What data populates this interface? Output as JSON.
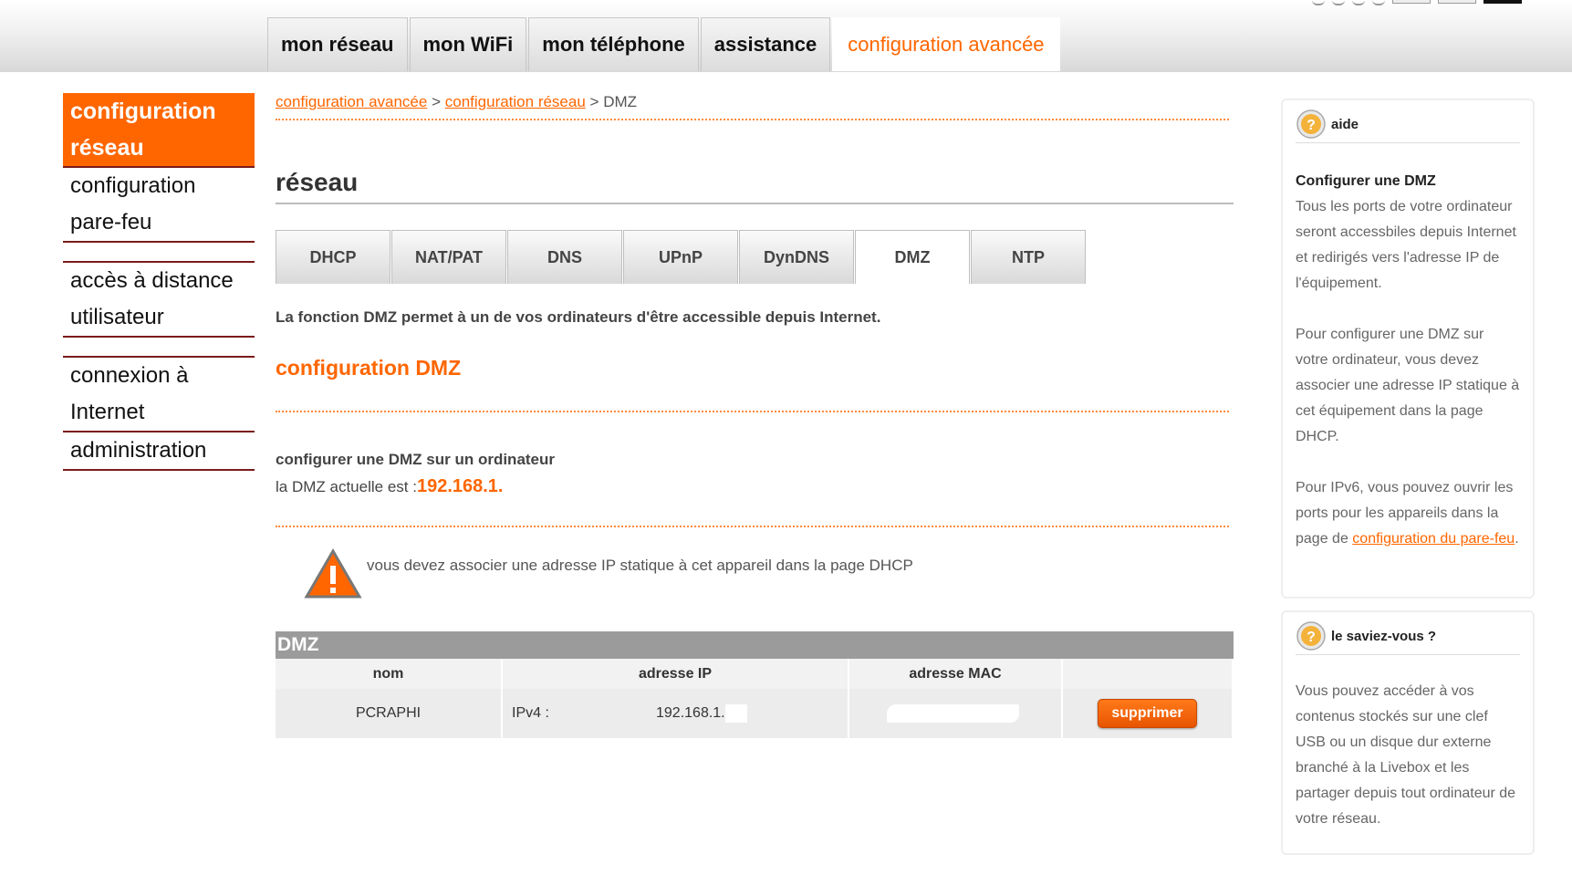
{
  "nav": {
    "tabs": [
      "mon réseau",
      "mon WiFi",
      "mon téléphone",
      "assistance",
      "configuration avancée"
    ],
    "active_index": 4
  },
  "sidebar": {
    "active_label": "configuration réseau",
    "items": [
      "configuration pare-feu",
      "accès à distance utilisateur",
      "connexion à Internet",
      "administration"
    ]
  },
  "breadcrumb": {
    "link1": "configuration avancée",
    "sep1": ">",
    "link2": "configuration réseau",
    "sep2": ">",
    "current": "DMZ"
  },
  "page": {
    "title": "réseau",
    "intro_prefix": "La fonction",
    "intro_bold": "DMZ",
    "intro_suffix": "permet à un de vos ordinateurs d'être accessible depuis Internet.",
    "section_title": "configuration DMZ",
    "dmz_heading": "configurer une DMZ sur un ordinateur",
    "dmz_current_label": "la DMZ actuelle est :",
    "dmz_current_ip": "192.168.1.",
    "warning_text": "vous devez associer une adresse IP statique à cet appareil dans la page DHCP"
  },
  "subtabs": {
    "items": [
      "DHCP",
      "NAT/PAT",
      "DNS",
      "UPnP",
      "DynDNS",
      "DMZ",
      "NTP"
    ],
    "active_index": 5
  },
  "dmz_table": {
    "title": "DMZ",
    "headers": [
      "nom",
      "adresse IP",
      "adresse MAC",
      ""
    ],
    "row": {
      "name": "PCRAPHI",
      "ip_type": "IPv4 :",
      "ip_value": "192.168.1.",
      "action": "supprimer"
    }
  },
  "help_panel": {
    "title": "aide",
    "heading": "Configurer une DMZ",
    "p1": "Tous les ports de votre ordinateur seront accessbiles depuis Internet et redirigés vers l'adresse IP de l'équipement.",
    "p2": "Pour configurer une DMZ sur votre ordinateur, vous devez associer une adresse IP statique à cet équipement dans la page DHCP.",
    "p3_prefix": "Pour IPv6, vous pouvez ouvrir les ports pour les appareils dans la page de",
    "p3_link": "configuration du pare-feu",
    "p3_suffix": "."
  },
  "tip_panel": {
    "title": "le saviez-vous ?",
    "text": "Vous pouvez accéder à vos contenus stockés sur une clef USB ou un disque dur externe branché à la Livebox et les partager depuis tout ordinateur de votre réseau."
  },
  "colors": {
    "brand_orange": "#ff6600",
    "sidebar_rule": "#7a1b1b",
    "table_title_bg": "#9b9b9b"
  },
  "icons": {
    "help": "question-icon",
    "warning": "warning-triangle-icon"
  }
}
